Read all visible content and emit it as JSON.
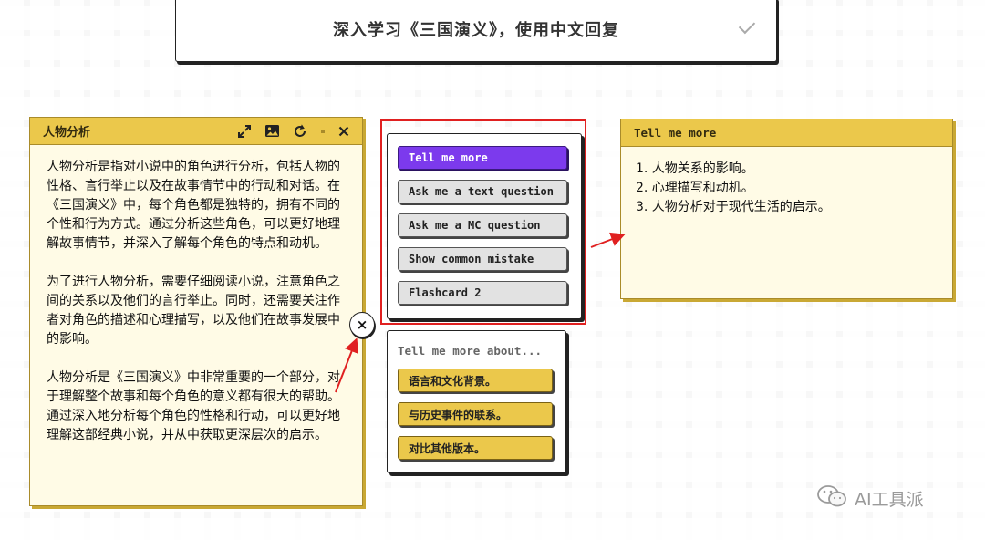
{
  "topbar": {
    "prompt": "深入学习《三国演义》，使用中文回复"
  },
  "left_card": {
    "title": "人物分析",
    "paragraphs": [
      "人物分析是指对小说中的角色进行分析，包括人物的性格、言行举止以及在故事情节中的行动和对话。在《三国演义》中，每个角色都是独特的，拥有不同的个性和行为方式。通过分析这些角色，可以更好地理解故事情节，并深入了解每个角色的特点和动机。",
      "为了进行人物分析，需要仔细阅读小说，注意角色之间的关系以及他们的言行举止。同时，还需要关注作者对角色的描述和心理描写，以及他们在故事发展中的影响。",
      "人物分析是《三国演义》中非常重要的一个部分，对于理解整个故事和每个角色的意义都有很大的帮助。通过深入地分析每个角色的性格和行动，可以更好地理解这部经典小说，并从中获取更深层次的启示。"
    ],
    "icons": [
      "expand-icon",
      "image-icon",
      "refresh-icon",
      "close-icon"
    ]
  },
  "menu": {
    "items": [
      "Tell me more",
      "Ask me a text question",
      "Ask me a MC question",
      "Show common mistake",
      "Flashcard 2"
    ],
    "active_index": 0
  },
  "suggestions": {
    "title": "Tell me more about...",
    "items": [
      "语言和文化背景。",
      "与历史事件的联系。",
      "对比其他版本。"
    ]
  },
  "right_card": {
    "title": "Tell me more",
    "items": [
      "1. 人物关系的影响。",
      "2. 心理描写和动机。",
      "3. 人物分析对于现代生活的启示。"
    ]
  },
  "close_button": {
    "glyph": "×"
  },
  "watermark": {
    "text": "AI工具派"
  },
  "colors": {
    "accent": "#7c3aed",
    "card_header": "#ebc84b",
    "card_body": "#fffbe6",
    "annotation": "#e02020"
  }
}
